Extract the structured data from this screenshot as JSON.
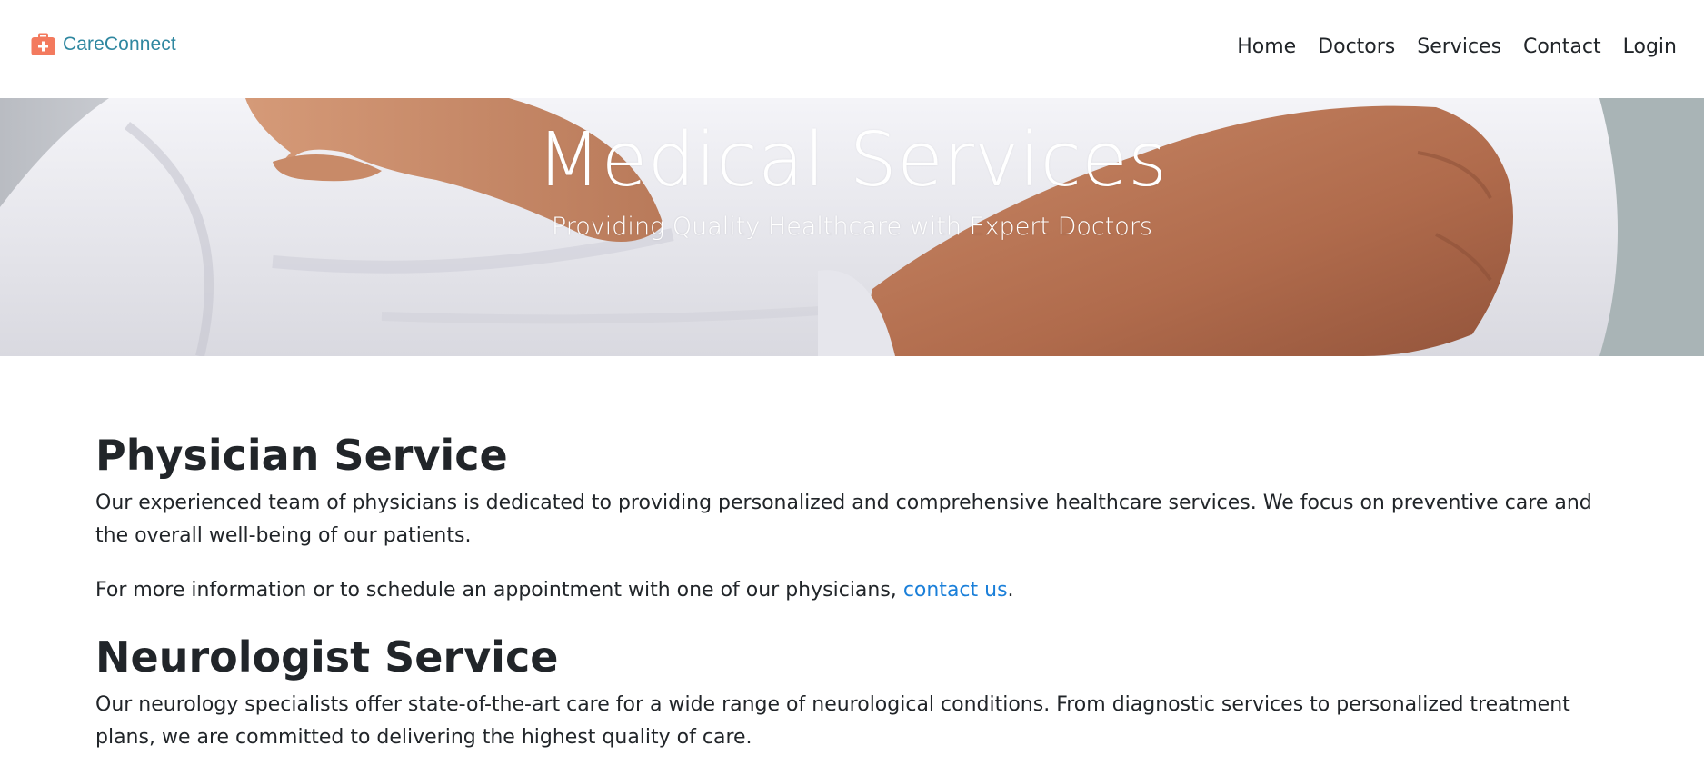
{
  "brand": {
    "name": "CareConnect",
    "icon": "medical-kit-icon",
    "icon_color": "#f37a5e",
    "text_color": "#2f87a0"
  },
  "nav": {
    "items": [
      {
        "label": "Home"
      },
      {
        "label": "Doctors"
      },
      {
        "label": "Services"
      },
      {
        "label": "Contact"
      },
      {
        "label": "Login"
      }
    ]
  },
  "hero": {
    "title": "Medical Services",
    "subtitle": "Providing Quality Healthcare with Expert Doctors",
    "image": "doctor-crossed-arms-white-coat"
  },
  "sections": [
    {
      "title": "Physician Service",
      "text": "Our experienced team of physicians is dedicated to providing personalized and comprehensive healthcare services. We focus on preventive care and the overall well-being of our patients.",
      "cta_prefix": "For more information or to schedule an appointment with one of our physicians, ",
      "cta_link": "contact us",
      "cta_suffix": "."
    },
    {
      "title": "Neurologist Service",
      "text": "Our neurology specialists offer state-of-the-art care for a wide range of neurological conditions. From diagnostic services to personalized treatment plans, we are committed to delivering the highest quality of care."
    }
  ],
  "colors": {
    "link": "#1a7fd9",
    "text": "#212529"
  }
}
